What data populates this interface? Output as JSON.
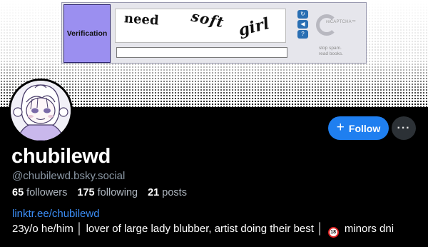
{
  "banner": {
    "captcha": {
      "label": "Verification",
      "words": [
        "need",
        "soft",
        "girl"
      ],
      "brand": "reCAPTCHA™",
      "tagline_1": "stop spam.",
      "tagline_2": "read books.",
      "buttons": {
        "refresh_icon": "refresh-icon",
        "audio_icon": "audio-icon",
        "help_icon": "help-icon"
      }
    }
  },
  "profile": {
    "display_name": "chubilewd",
    "handle": "@chubilewd.bsky.social",
    "stats": {
      "followers_count": "65",
      "followers_label": "followers",
      "following_count": "175",
      "following_label": "following",
      "posts_count": "21",
      "posts_label": "posts"
    },
    "bio_link": "linktr.ee/chubilewd",
    "bio_text_1": "23y/o he/him │ lover of large lady blubber, artist doing their best │",
    "no18_badge": "18",
    "bio_text_2": "minors dni"
  },
  "actions": {
    "follow_label": "Follow",
    "more_icon": "more-horizontal-icon"
  },
  "colors": {
    "background": "#000000",
    "accent": "#1f7ff0",
    "link": "#3b8df5",
    "muted_text": "#8b98a5"
  }
}
